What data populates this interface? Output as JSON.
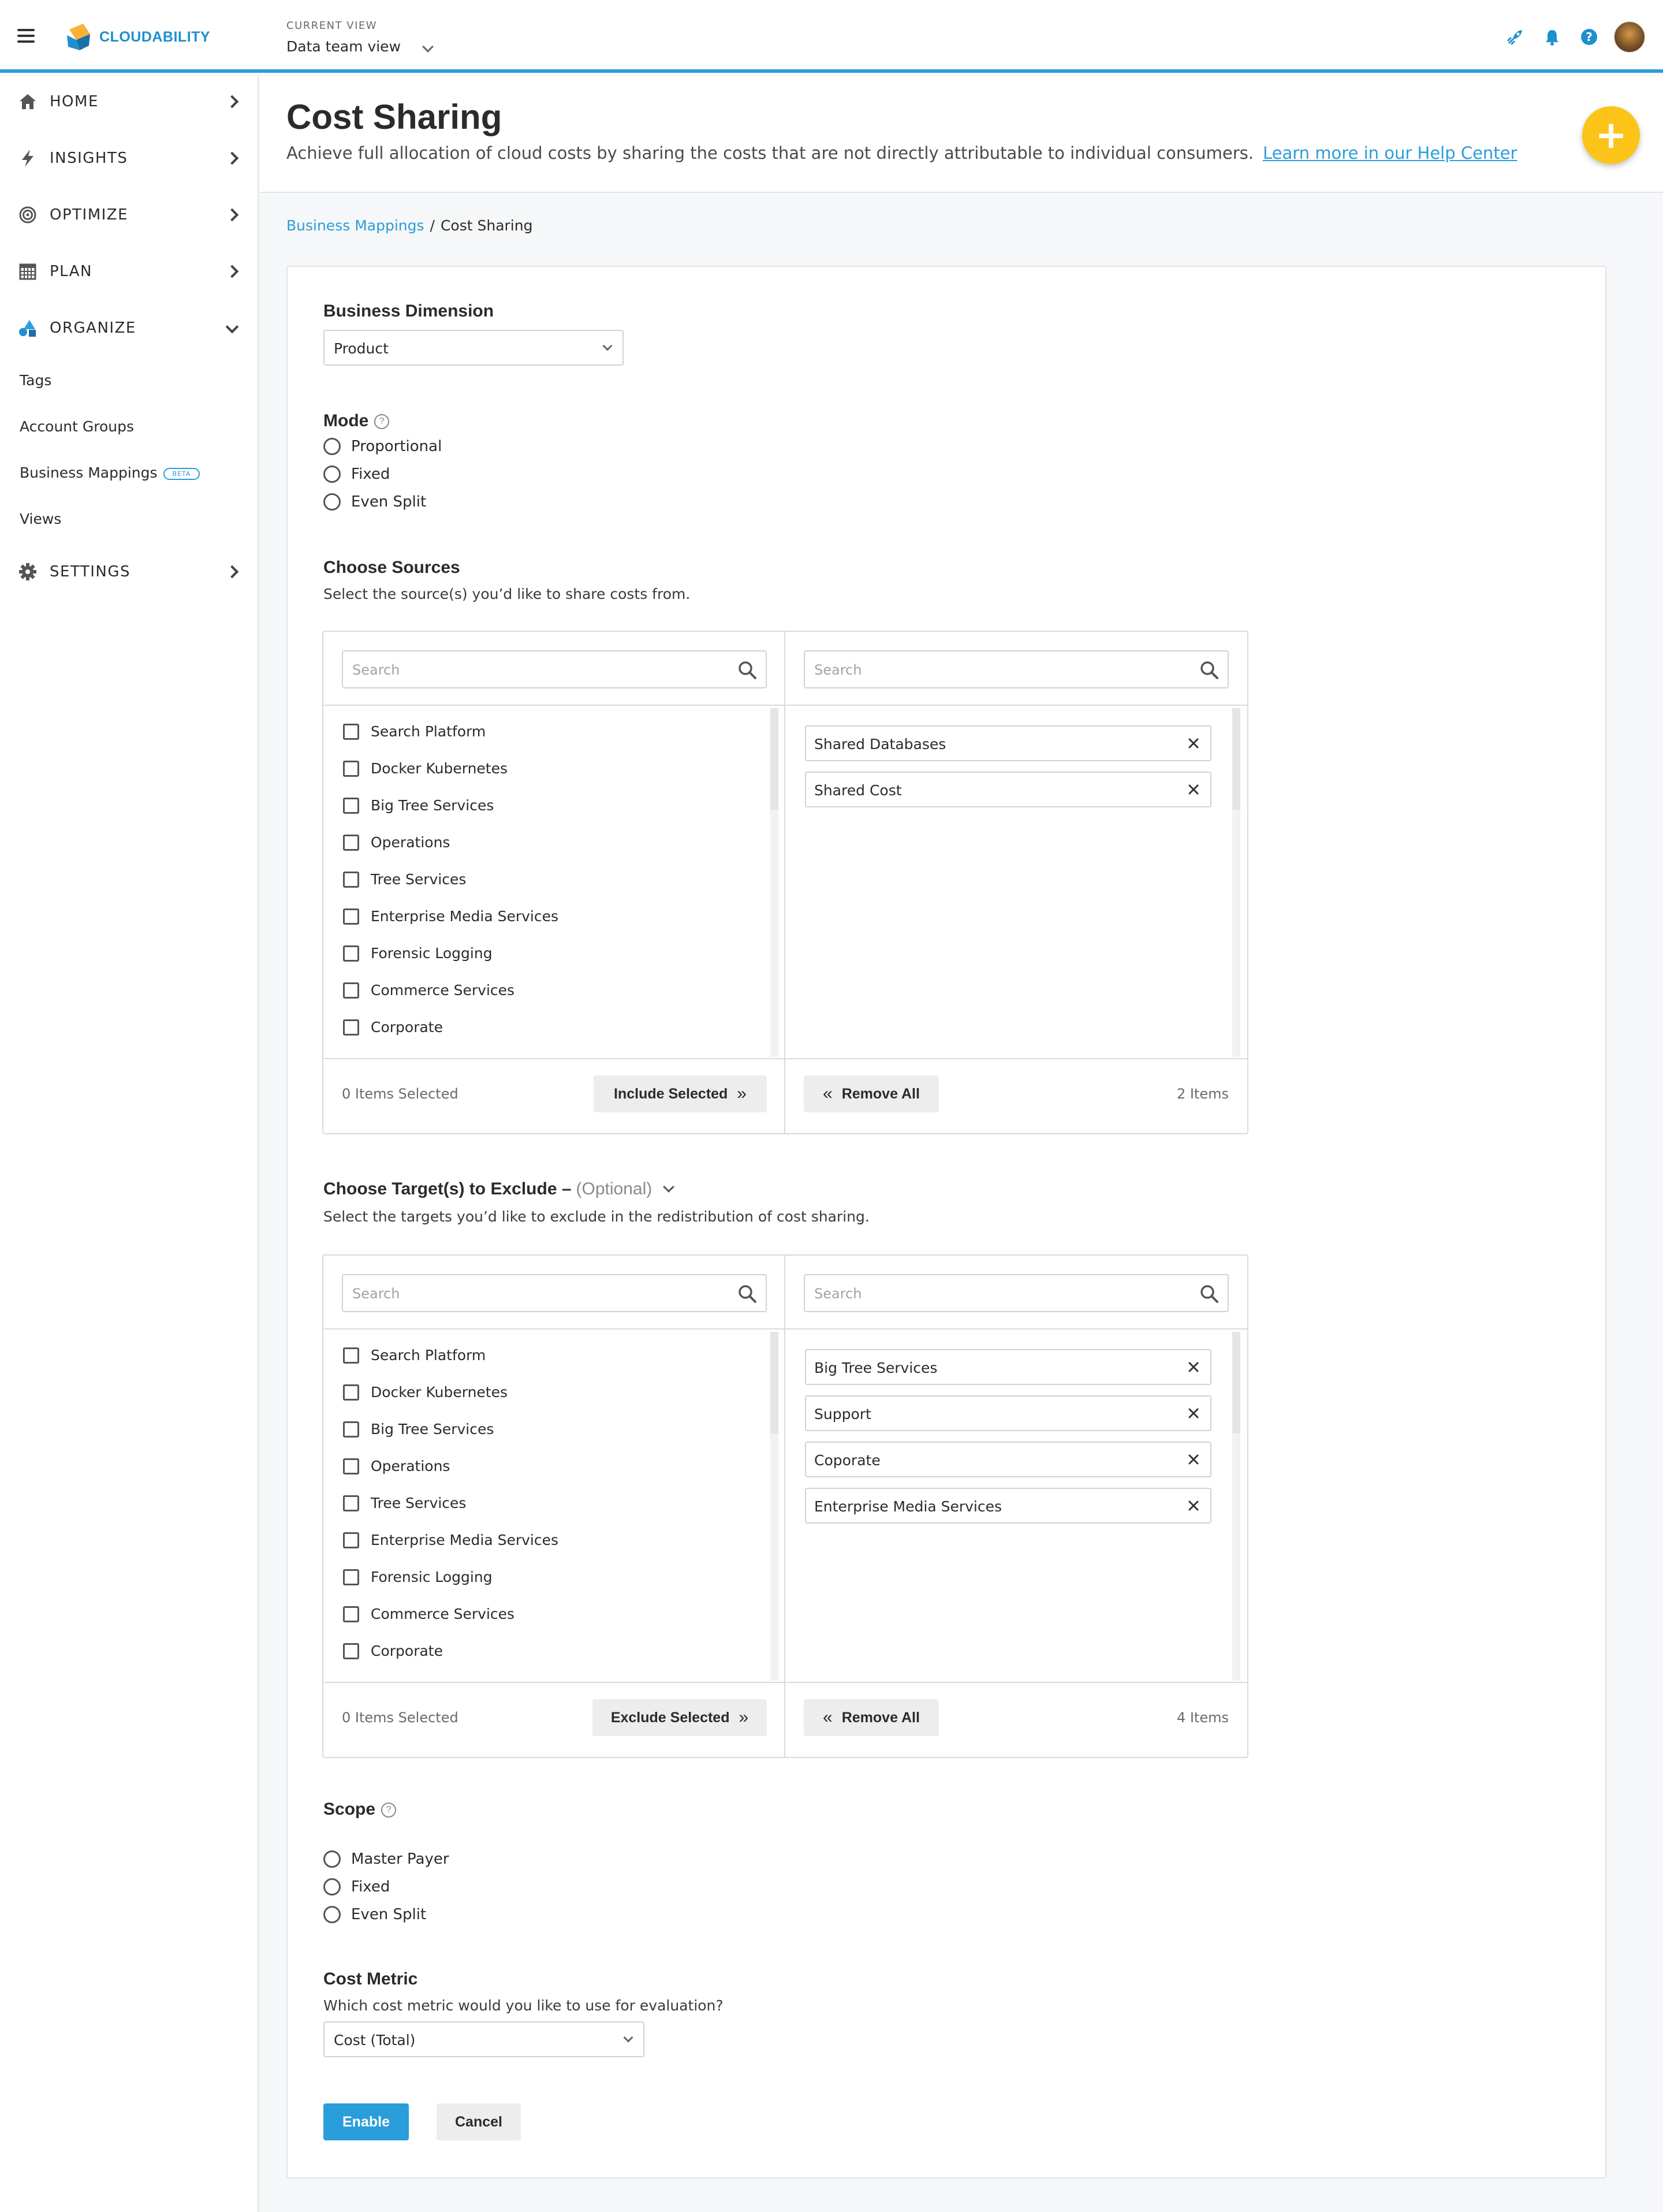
{
  "topbar": {
    "logo_text": "CLOUDABILITY",
    "current_view_label": "CURRENT VIEW",
    "current_view_value": "Data team view"
  },
  "sidebar": {
    "items": [
      {
        "label": "HOME",
        "icon": "home-icon"
      },
      {
        "label": "INSIGHTS",
        "icon": "bolt-icon"
      },
      {
        "label": "OPTIMIZE",
        "icon": "target-icon"
      },
      {
        "label": "PLAN",
        "icon": "calendar-icon"
      },
      {
        "label": "ORGANIZE",
        "icon": "shapes-icon"
      },
      {
        "label": "SETTINGS",
        "icon": "gear-icon"
      }
    ],
    "organize_sub": [
      "Tags",
      "Account Groups",
      "Business Mappings",
      "Views"
    ],
    "beta_badge": "BETA"
  },
  "header": {
    "title": "Cost Sharing",
    "subtitle": "Achieve full allocation of cloud costs by sharing the costs that are not directly attributable to individual consumers.",
    "help_link": "Learn more in our Help Center",
    "add_button": "+"
  },
  "breadcrumb": {
    "parent": "Business Mappings",
    "separator": "/",
    "current": "Cost Sharing"
  },
  "form": {
    "business_dimension": {
      "label": "Business Dimension",
      "value": "Product"
    },
    "mode": {
      "label": "Mode",
      "help": "?",
      "options": [
        "Proportional",
        "Fixed",
        "Even Split"
      ]
    },
    "sources": {
      "label": "Choose Sources",
      "description": "Select the source(s) you’d like to share costs from.",
      "search_placeholder": "Search",
      "available": [
        "Search Platform",
        "Docker Kubernetes",
        "Big Tree Services",
        "Operations",
        "Tree Services",
        "Enterprise Media Services",
        "Forensic Logging",
        "Commerce Services",
        "Corporate"
      ],
      "selected": [
        "Shared Databases",
        "Shared Cost"
      ],
      "selected_count_text": "0 Items Selected",
      "include_button": "Include Selected",
      "remove_all_button": "Remove All",
      "items_count_text": "2 Items"
    },
    "exclude": {
      "label": "Choose Target(s) to Exclude –",
      "optional": "(Optional)",
      "description": "Select the targets you’d like to exclude in the redistribution of cost sharing.",
      "search_placeholder": "Search",
      "available": [
        "Search Platform",
        "Docker Kubernetes",
        "Big Tree Services",
        "Operations",
        "Tree Services",
        "Enterprise Media Services",
        "Forensic Logging",
        "Commerce Services",
        "Corporate"
      ],
      "selected": [
        "Big Tree Services",
        "Support",
        "Coporate",
        "Enterprise Media Services"
      ],
      "selected_count_text": "0 Items Selected",
      "exclude_button": "Exclude Selected",
      "remove_all_button": "Remove All",
      "items_count_text": "4 Items"
    },
    "scope": {
      "label": "Scope",
      "help": "?",
      "options": [
        "Master Payer",
        "Fixed",
        "Even Split"
      ]
    },
    "cost_metric": {
      "label": "Cost Metric",
      "description": "Which cost metric would you like to use for evaluation?",
      "value": "Cost (Total)"
    },
    "enable_button": "Enable",
    "cancel_button": "Cancel"
  },
  "colors": {
    "accent": "#2a9ddb",
    "fab": "#fcc419"
  }
}
